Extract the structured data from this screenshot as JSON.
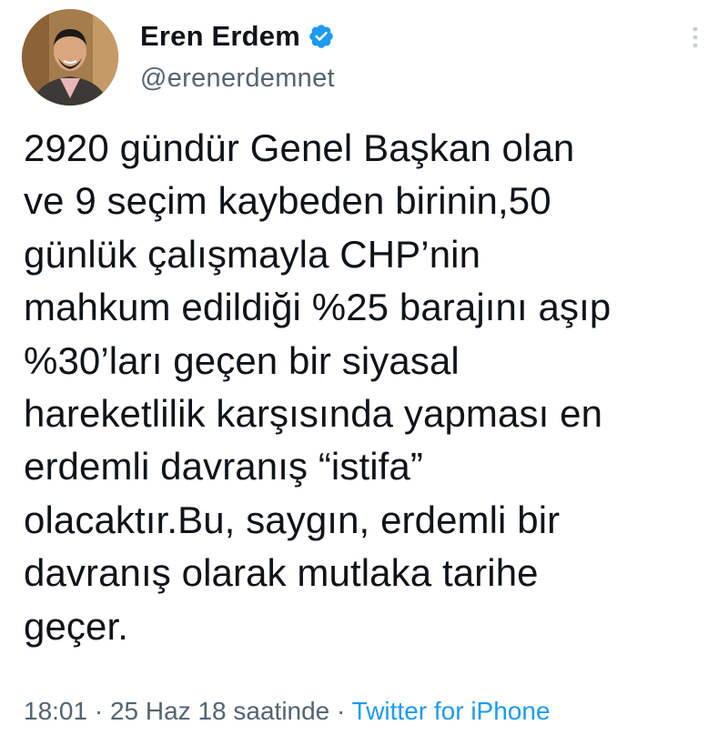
{
  "tweet": {
    "author": {
      "display_name": "Eren Erdem",
      "handle": "@erenerdemnet",
      "verified": true,
      "verified_color": "#1d9bf0"
    },
    "text_lines": [
      "2920 gündür Genel Başkan olan",
      "ve 9 seçim kaybeden birinin,50",
      "günlük çalışmayla CHP’nin",
      "mahkum edildiği %25 barajını aşıp",
      "%30’ları geçen bir siyasal",
      "hareketlilik karşısında yapması en",
      "erdemli davranış “istifa”",
      "olacaktır.Bu, saygın, erdemli bir",
      "davranış olarak mutlaka tarihe",
      "geçer."
    ],
    "meta": {
      "time": "18:01",
      "separator": " · ",
      "date": "25 Haz 18 saatinde",
      "source": "Twitter for iPhone"
    },
    "icons": {
      "menu": "more-vertical-icon",
      "verified": "verified-badge-icon"
    },
    "colors": {
      "text": "#0f1419",
      "secondary": "#536471",
      "link": "#1d9bf0"
    }
  }
}
